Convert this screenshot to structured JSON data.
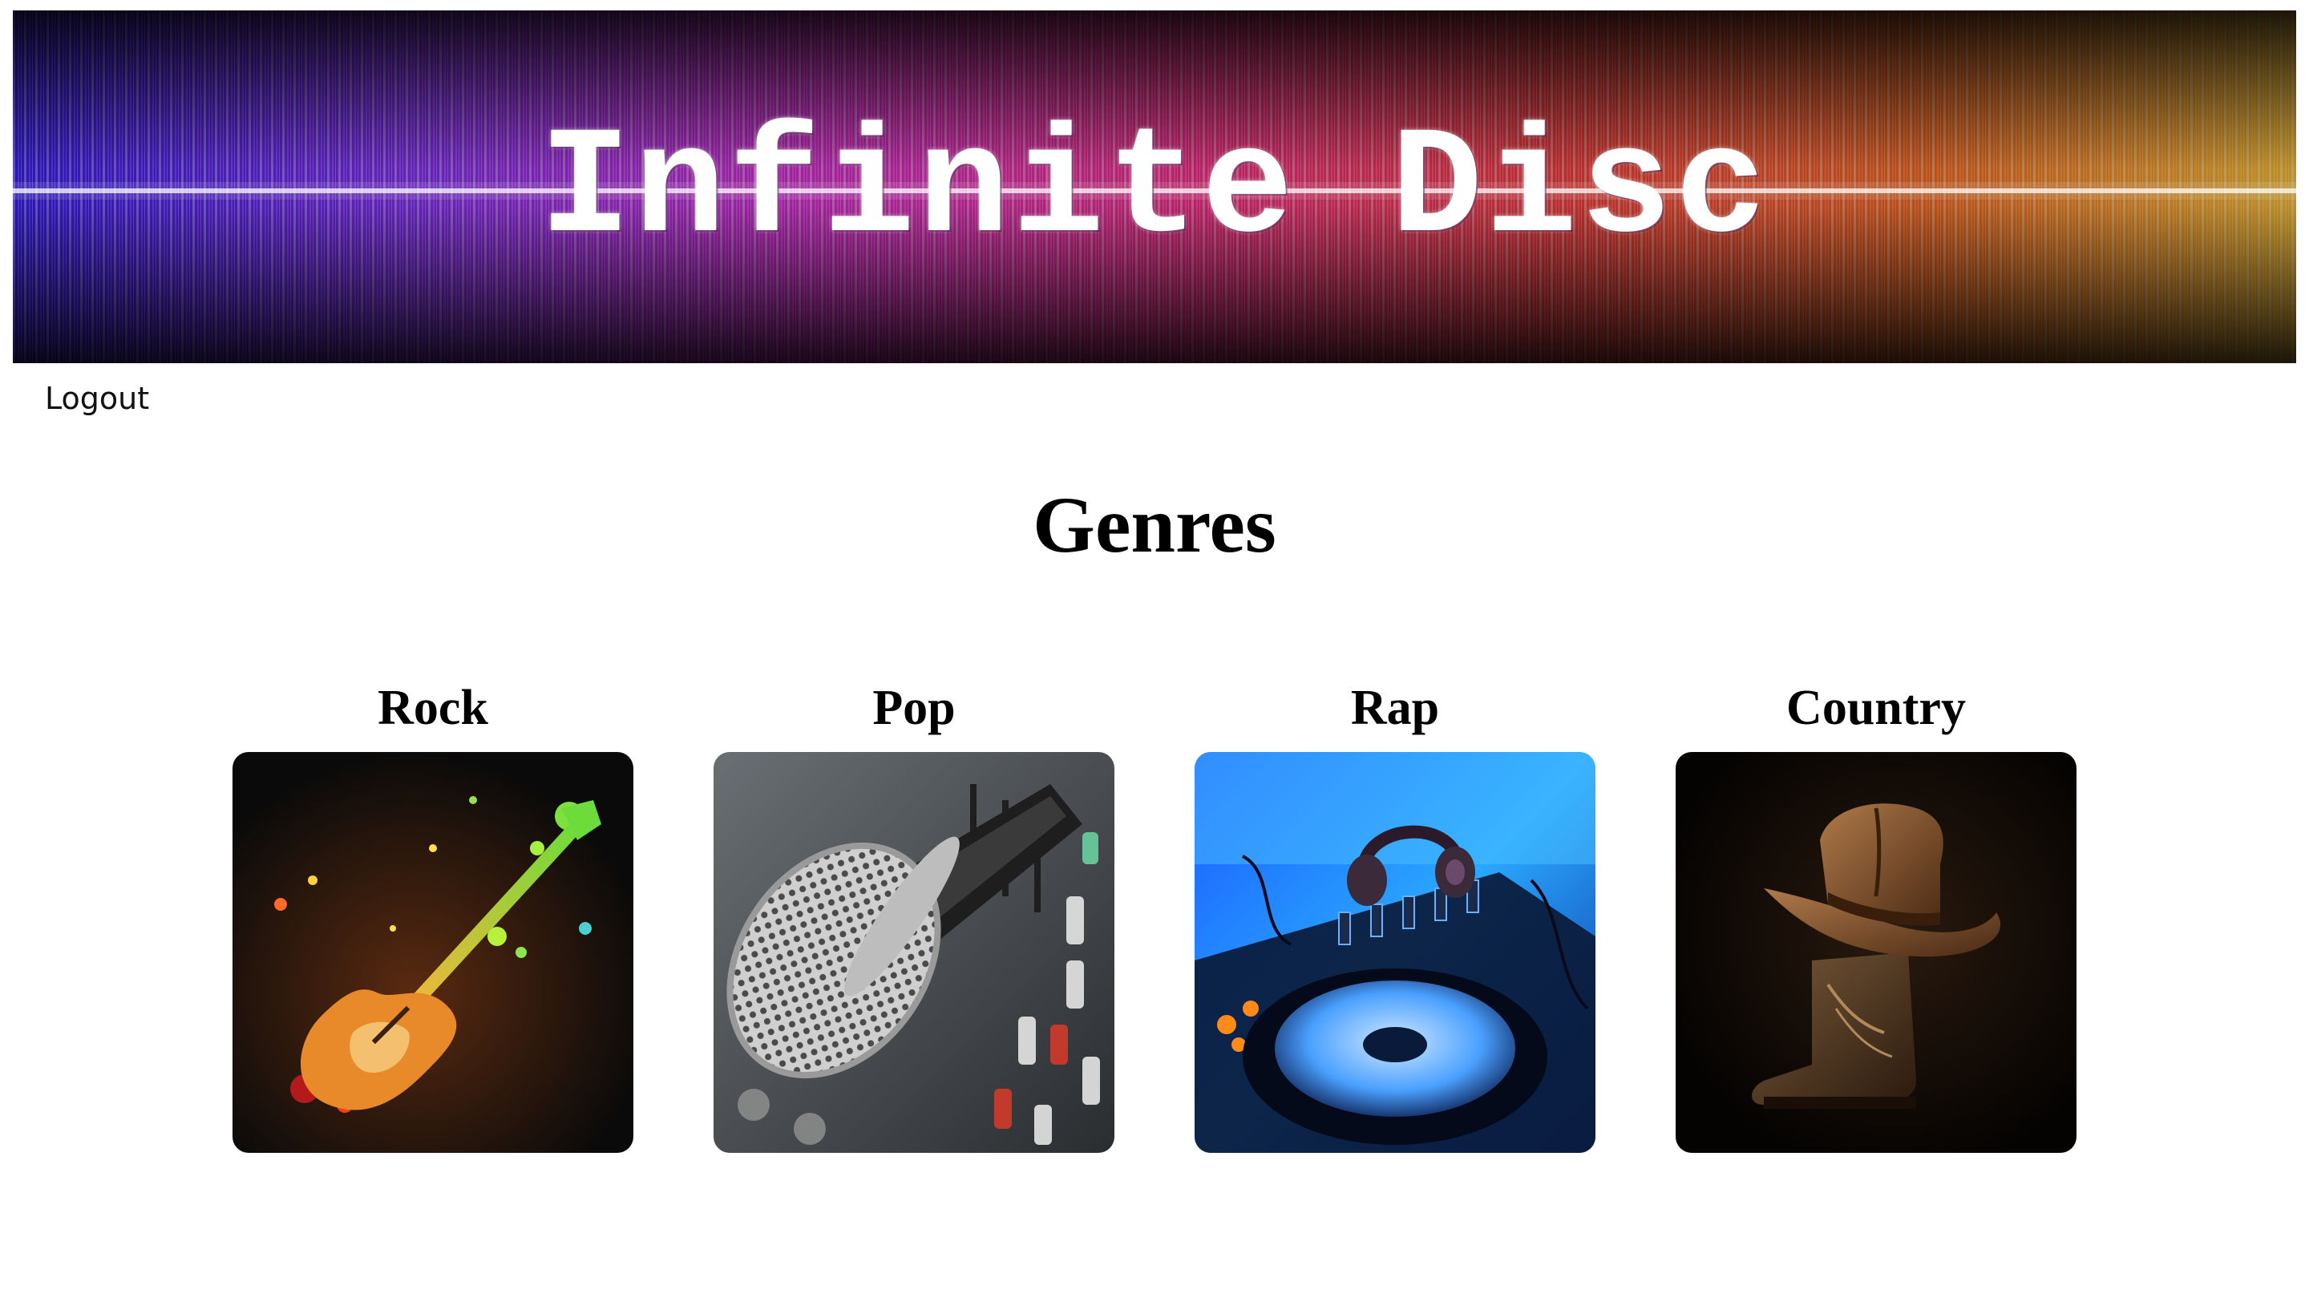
{
  "banner": {
    "title": "Infinite Disc"
  },
  "nav": {
    "logout_label": "Logout"
  },
  "page": {
    "title": "Genres"
  },
  "genres": [
    {
      "name": "Rock",
      "icon": "electric-guitar-paint-splash"
    },
    {
      "name": "Pop",
      "icon": "microphone-on-mixer"
    },
    {
      "name": "Rap",
      "icon": "dj-turntable-headphones"
    },
    {
      "name": "Country",
      "icon": "cowboy-hat-and-boot"
    }
  ],
  "colors": {
    "background": "#ffffff",
    "banner_background": "#000000",
    "text": "#000000"
  }
}
